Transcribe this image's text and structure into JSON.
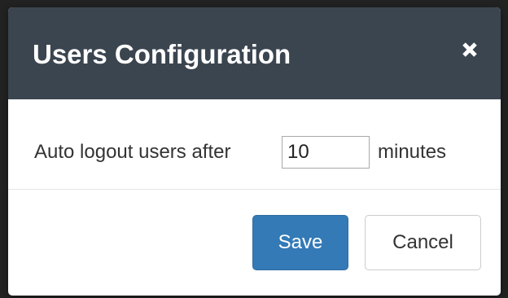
{
  "dialog": {
    "title": "Users Configuration",
    "close_icon": "close-icon"
  },
  "body": {
    "label_before": "Auto logout users after",
    "minutes_value": "10",
    "label_after": "minutes"
  },
  "footer": {
    "save_label": "Save",
    "cancel_label": "Cancel"
  },
  "colors": {
    "header_bg": "#3b4550",
    "primary": "#337ab7",
    "text": "#333333"
  }
}
